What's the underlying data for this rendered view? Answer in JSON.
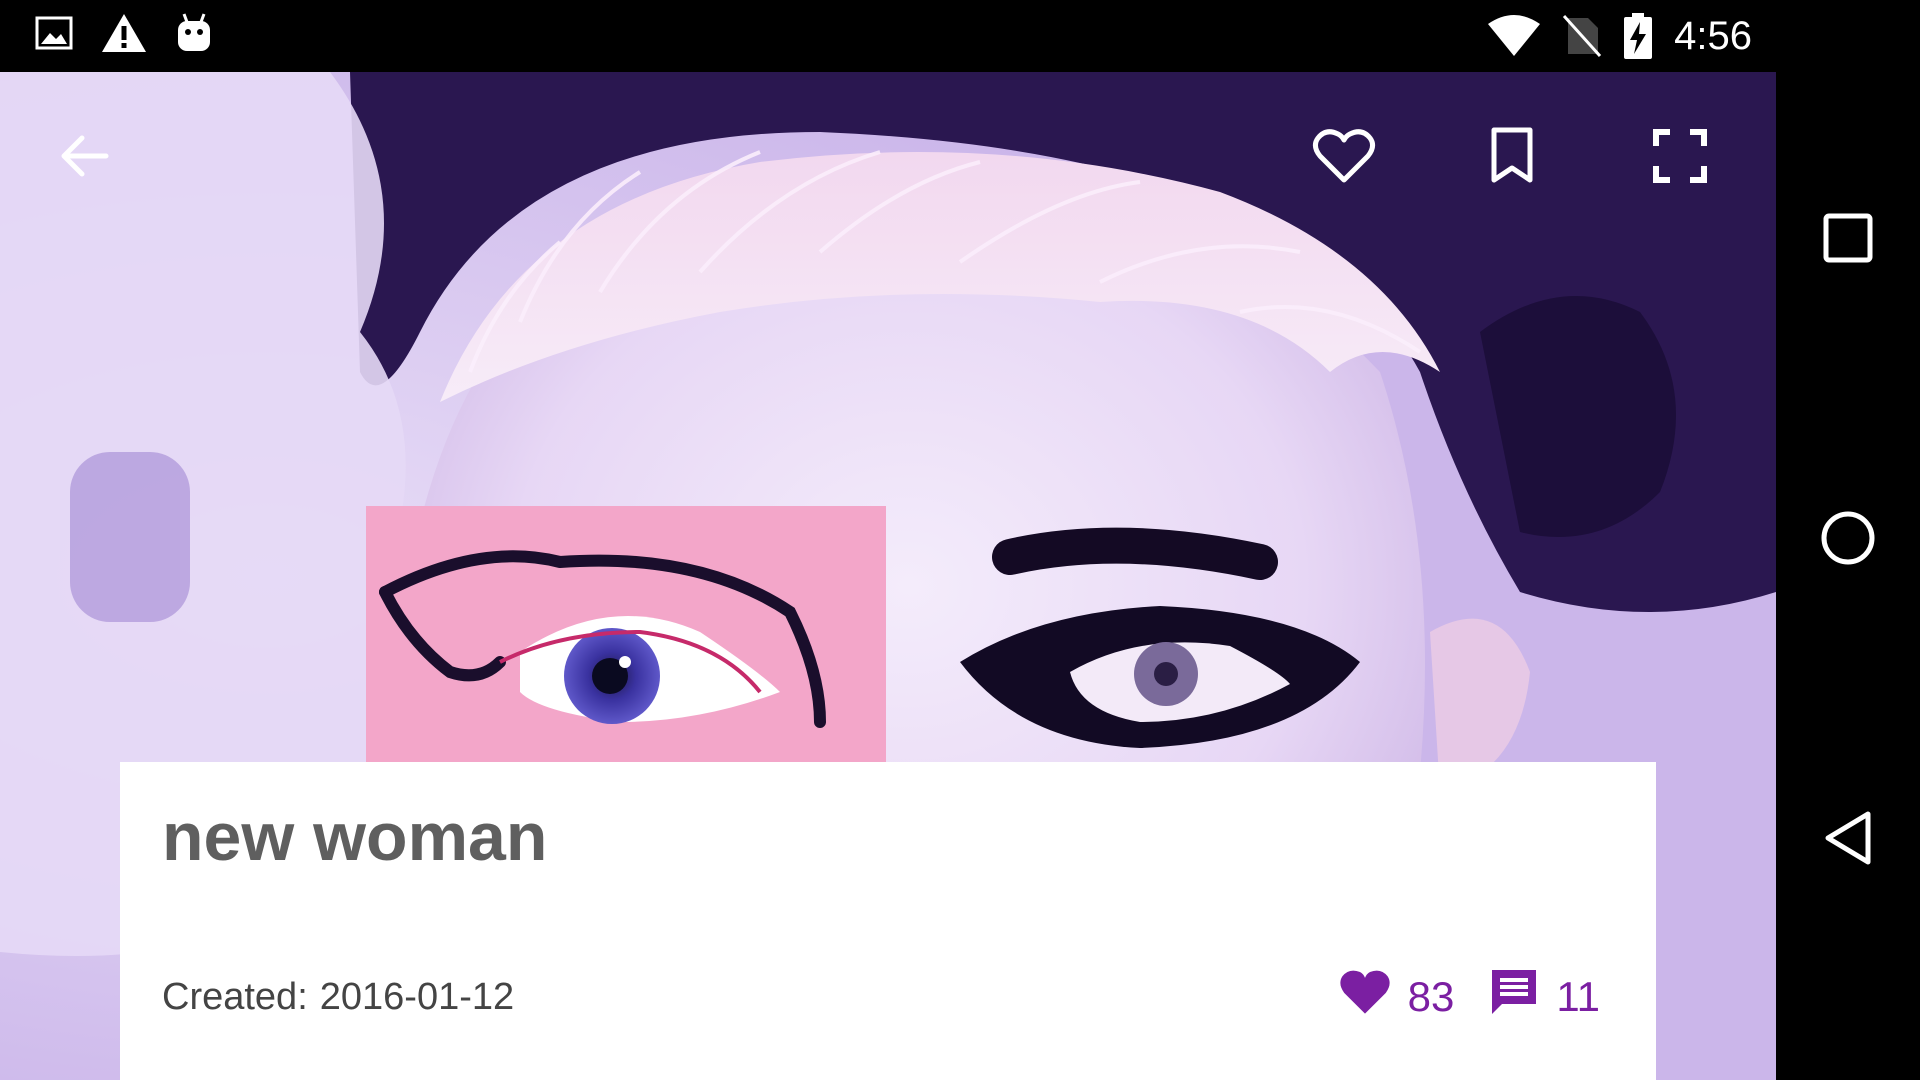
{
  "status_bar": {
    "time": "4:56",
    "left_icons": [
      "image-icon",
      "warning-icon",
      "android-icon"
    ],
    "right_icons": [
      "wifi-icon",
      "no-sim-icon",
      "battery-charging-icon"
    ]
  },
  "toolbar": {
    "back_icon": "arrow-back-icon",
    "actions": [
      "heart-outline-icon",
      "bookmark-icon",
      "fullscreen-icon"
    ]
  },
  "post": {
    "title": "new woman",
    "created_label": "Created:",
    "created_date": "2016-01-12",
    "likes": "83",
    "comments": "11"
  },
  "colors": {
    "accent": "#7b1fa2",
    "title": "#5f5f5f",
    "card_bg": "#ffffff"
  },
  "nav_bar": {
    "buttons": [
      "recents-icon",
      "home-icon",
      "back-icon"
    ]
  }
}
